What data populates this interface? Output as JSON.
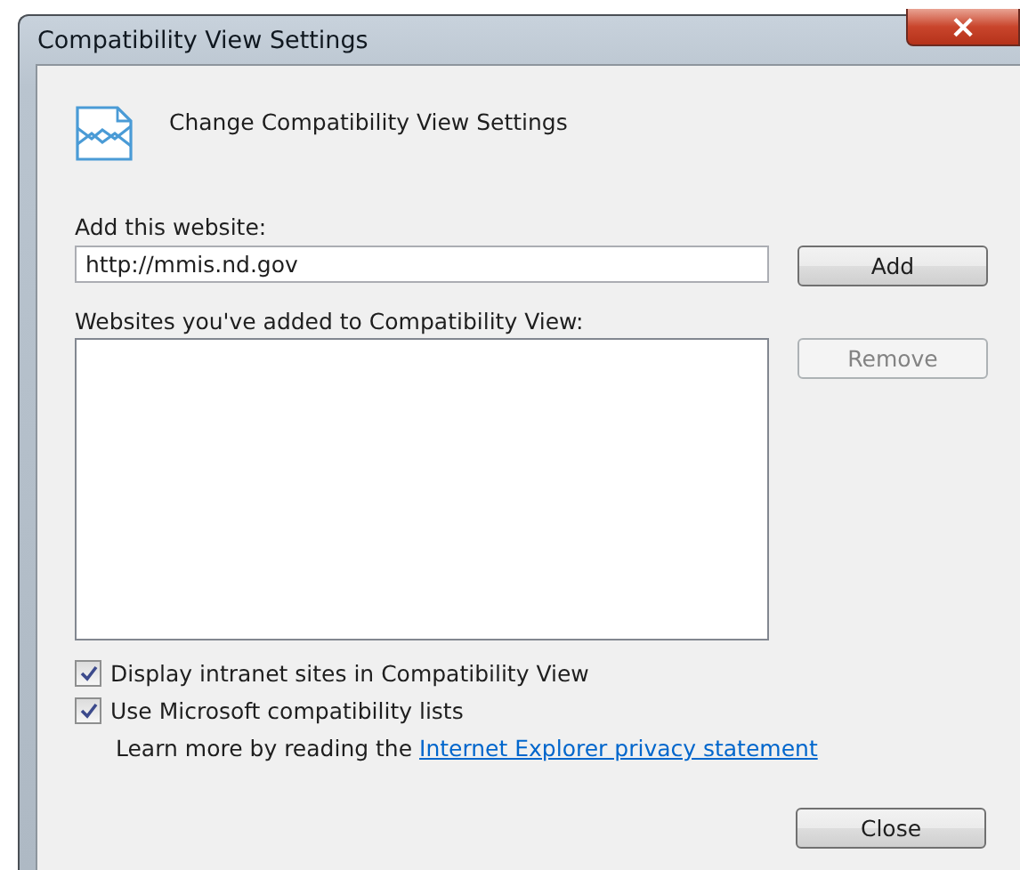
{
  "window": {
    "title": "Compatibility View Settings",
    "close_label": "×"
  },
  "header": {
    "text": "Change Compatibility View Settings"
  },
  "add_field": {
    "label": "Add this website:",
    "value": "http://mmis.nd.gov"
  },
  "list": {
    "label": "Websites you've added to Compatibility View:"
  },
  "buttons": [
    {
      "label": "Add",
      "disabled": false
    },
    {
      "label": "Remove",
      "disabled": true
    },
    {
      "label": "Close",
      "disabled": false
    }
  ],
  "options": [
    {
      "label": "Display intranet sites in Compatibility View",
      "checked": true
    },
    {
      "label": "Use Microsoft compatibility lists",
      "checked": true
    }
  ],
  "learn_more": {
    "text": "Learn more by reading the",
    "link": "Internet Explorer privacy statement"
  }
}
